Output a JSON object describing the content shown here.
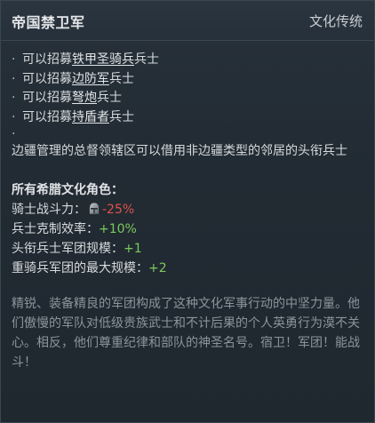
{
  "header": {
    "title": "帝国禁卫军",
    "tag": "文化传统"
  },
  "recruit": [
    {
      "prefix": "可以招募",
      "unit": "铁甲圣骑兵",
      "suffix": "兵士"
    },
    {
      "prefix": "可以招募",
      "unit": "边防军",
      "suffix": "兵士"
    },
    {
      "prefix": "可以招募",
      "unit": "弩炮",
      "suffix": "兵士"
    },
    {
      "prefix": "可以招募",
      "unit": "持盾者",
      "suffix": "兵士"
    }
  ],
  "bullet_char": "·",
  "description": "边疆管理的总督领辖区可以借用非边疆类型的邻居的头衔兵士",
  "modifiers": {
    "section_title": "所有希腊文化角色：",
    "items": [
      {
        "label": "骑士战斗力：",
        "value": "-25%",
        "kind": "negative",
        "icon": "knight-helmet-icon"
      },
      {
        "label": "兵士克制效率：",
        "value": "+10%",
        "kind": "positive"
      },
      {
        "label": "头衔兵士军团规模：",
        "value": "+1",
        "kind": "positive"
      },
      {
        "label": "重骑兵军团的最大规模：",
        "value": "+2",
        "kind": "positive"
      }
    ]
  },
  "flavor": "精锐、装备精良的军团构成了这种文化军事行动的中坚力量。他们傲慢的军队对低级贵族武士和不计后果的个人英勇行为漠不关心。相反，他们尊重纪律和部队的神圣名号。宿卫！军团！能战斗！",
  "colors": {
    "negative": "#e0534a",
    "positive": "#7bc95c"
  }
}
